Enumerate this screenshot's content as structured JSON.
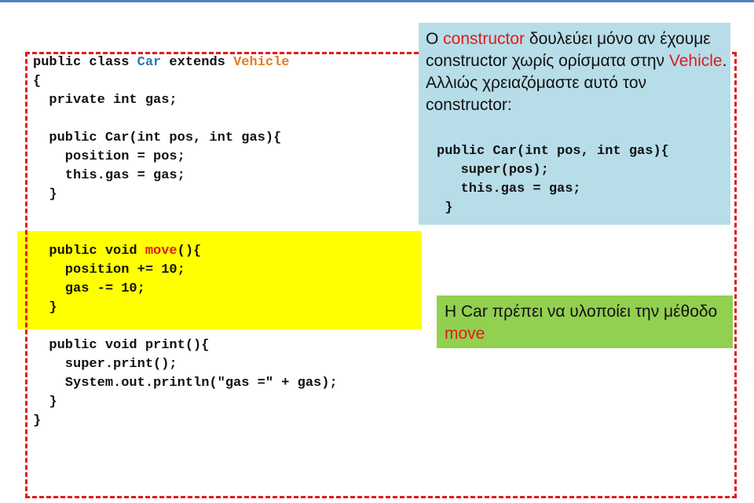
{
  "colors": {
    "frame": "#e01b1b",
    "highlight_yellow": "#ffff00",
    "note_blue": "#b7dde8",
    "note_green": "#92d050",
    "class_name": "#2e75b6",
    "superclass_name": "#e07b24",
    "emphasis_red": "#e01b1b"
  },
  "code": {
    "class_decl": {
      "prefix": "public class ",
      "class_name": "Car",
      "middle": " extends ",
      "superclass": "Vehicle"
    },
    "open_brace": "{",
    "field": "  private int gas;",
    "constructor": [
      "  public Car(int pos, int gas){",
      "    position = pos;",
      "    this.gas = gas;",
      "  }"
    ],
    "move_method": {
      "prefix": "  public void ",
      "name": "move",
      "suffix": "(){",
      "body": [
        "    position += 10;",
        "    gas -= 10;",
        "  }"
      ]
    },
    "print_method": [
      "  public void print(){",
      "    super.print();",
      "    System.out.println(\"gas =\" + gas);",
      "  }"
    ],
    "close_brace": "}"
  },
  "blue_note": {
    "line1_prefix": "Ο ",
    "line1_emph": "constructor",
    "line1_suffix": " δουλεύει μόνο αν έχουμε constructor χωρίς ορίσματα στην ",
    "line2_emph": "Vehicle",
    "line2_suffix": ". Αλλιώς χρειαζόμαστε αυτό τον constructor:",
    "code": [
      "public Car(int pos, int gas){",
      "   super(pos);",
      "   this.gas = gas;",
      " }"
    ]
  },
  "green_note": {
    "prefix": "Η Car πρέπει να υλοποίει την μέθοδο ",
    "emph": "move"
  }
}
